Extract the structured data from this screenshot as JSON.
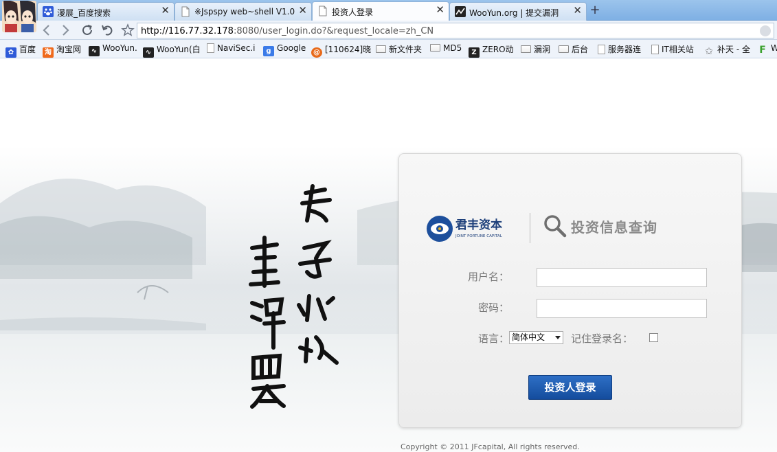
{
  "browser": {
    "tabs": [
      {
        "title": "漫展_百度搜索",
        "icon": "paw-icon",
        "active": false
      },
      {
        "title": "※Jspspy web~shell V1.0",
        "icon": "page-icon",
        "active": false
      },
      {
        "title": "投资人登录",
        "icon": "page-icon",
        "active": true
      },
      {
        "title": "WooYun.org | 提交漏洞",
        "icon": "wooyun-icon",
        "active": false
      }
    ],
    "new_tab_symbol": "+",
    "close_symbol": "✕",
    "address": {
      "host": "http://116.77.32.178",
      "rest": ":8080/user_login.do?&request_locale=zh_CN"
    },
    "bookmarks": [
      {
        "label": "百度",
        "icon": "paw-icon"
      },
      {
        "label": "淘宝网",
        "icon": "taobao-icon"
      },
      {
        "label": "WooYun.",
        "icon": "wooyun-icon"
      },
      {
        "label": "WooYun(白",
        "icon": "wooyun-icon"
      },
      {
        "label": "NaviSec.i",
        "icon": "page-icon"
      },
      {
        "label": "Google",
        "icon": "google-icon"
      },
      {
        "label": "[110624]晓",
        "icon": "swirl-icon"
      },
      {
        "label": "新文件夹",
        "icon": "folder-icon"
      },
      {
        "label": "MD5",
        "icon": "folder-icon"
      },
      {
        "label": "ZERO动",
        "icon": "zero-icon"
      },
      {
        "label": "漏洞",
        "icon": "folder-icon"
      },
      {
        "label": "后台",
        "icon": "folder-icon"
      },
      {
        "label": "服务器连",
        "icon": "page-icon"
      },
      {
        "label": "IT相关站",
        "icon": "page-icon"
      },
      {
        "label": "补天 - 全",
        "icon": "star-icon"
      },
      {
        "label": "W",
        "icon": "f-icon"
      }
    ]
  },
  "page": {
    "brand_name": "君丰资本",
    "brand_subtitle": "JOINT FORTUNE CAPITAL",
    "query_title": "投资信息查询",
    "calligraphy": [
      "君子如水",
      "豐澤四方"
    ],
    "form": {
      "username_label": "用户名：",
      "username_value": "",
      "password_label": "密码：",
      "password_value": "",
      "language_label": "语言：",
      "language_selected": "简体中文",
      "remember_label": "记住登录名：",
      "remember_checked": false,
      "login_button": "投资人登录"
    },
    "copyright": "Copyright © 2011 JFcapital, All rights reserved."
  }
}
